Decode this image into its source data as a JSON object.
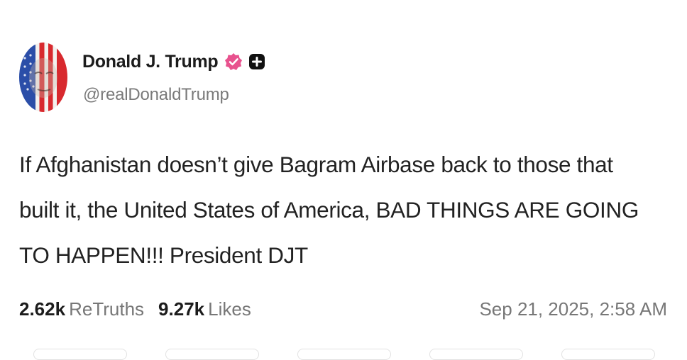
{
  "author": {
    "display_name": "Donald J. Trump",
    "handle": "@realDonaldTrump",
    "verified_icon": "verified-badge-icon",
    "verified_color": "#e8528e",
    "plus_icon": "plus-badge-icon"
  },
  "post": {
    "text": "If Afghanistan doesn’t give Bagram Airbase back to those that built it, the United States of America, BAD THINGS ARE GOING TO HAPPEN!!! President DJT"
  },
  "stats": {
    "retruths_count": "2.62k",
    "retruths_label": "ReTruths",
    "likes_count": "9.27k",
    "likes_label": "Likes"
  },
  "timestamp": "Sep 21, 2025, 2:58 AM",
  "colors": {
    "text_primary": "#1c1c1c",
    "text_secondary": "#777777",
    "background": "#ffffff"
  }
}
